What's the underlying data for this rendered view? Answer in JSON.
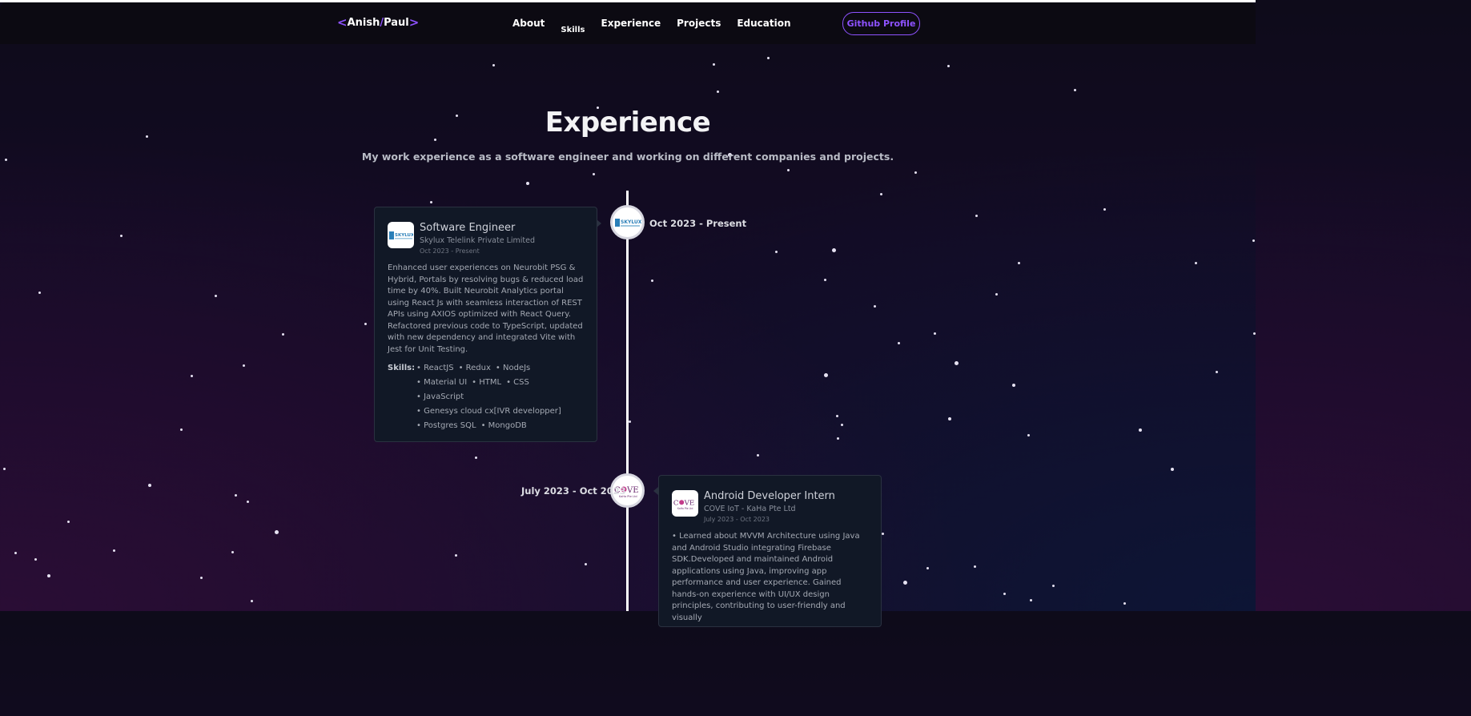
{
  "navbar": {
    "logo_left": "<",
    "logo_first": "Anish",
    "logo_sep": "/",
    "logo_last": "Paul",
    "logo_right": ">",
    "links": [
      "About",
      "Skills",
      "Experience",
      "Projects",
      "Education"
    ],
    "github_button": "Github Profile"
  },
  "section": {
    "title": "Experience",
    "subtitle": "My work experience as a software engineer and working on different companies and projects."
  },
  "experiences": [
    {
      "timeline_date": "Oct 2023 - Present",
      "role": "Software Engineer",
      "company": "Skylux Telelink Private Limited",
      "dates": "Oct 2023 - Present",
      "logo_text": "SKYLUX",
      "description": "Enhanced user experiences on Neurobit PSG & Hybrid, Portals by resolving bugs & reduced load time by 40%. Built Neurobit Analytics portal using React Js with seamless interaction of REST APIs using AXIOS optimized with React Query. Refactored previous code to TypeScript, updated with new dependency and integrated Vite with Jest for Unit Testing.",
      "skills_label": "Skills:",
      "skills": [
        "• ReactJS",
        "• Redux",
        "• NodeJs",
        "• Material UI",
        "• HTML",
        "• CSS",
        "• JavaScript",
        "• Genesys cloud cx[IVR developper]",
        "• Postgres SQL",
        "• MongoDB"
      ]
    },
    {
      "timeline_date": "July 2023 - Oct 2023",
      "role": "Android Developer Intern",
      "company": "COVE IoT - KaHa Pte Ltd",
      "dates": "July 2023 - Oct 2023",
      "logo_text": "COVE",
      "description": "• Learned about MVVM Architecture using Java and Android Studio integrating Firebase SDK.Developed and maintained Android applications using Java, improving app performance and user experience. Gained hands-on experience with UI/UX design principles, contributing to user-friendly and visually"
    }
  ],
  "colors": {
    "accent": "#8e52ff",
    "card_bg": "#111826",
    "timeline": "#ffffff"
  }
}
